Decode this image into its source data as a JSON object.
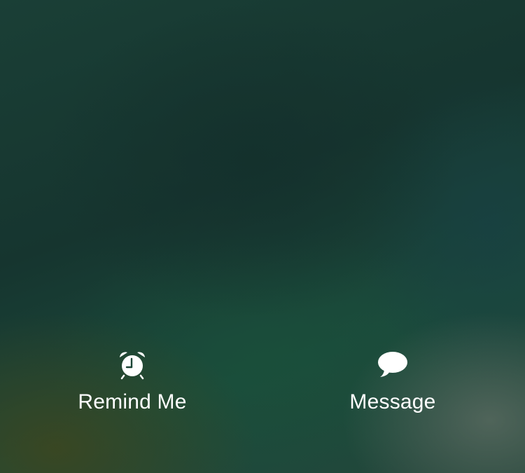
{
  "actions": {
    "remind": {
      "label": "Remind Me",
      "icon": "alarm-clock-icon"
    },
    "message": {
      "label": "Message",
      "icon": "speech-bubble-icon"
    }
  },
  "colors": {
    "text": "#ffffff",
    "background": "#1a3f36"
  }
}
